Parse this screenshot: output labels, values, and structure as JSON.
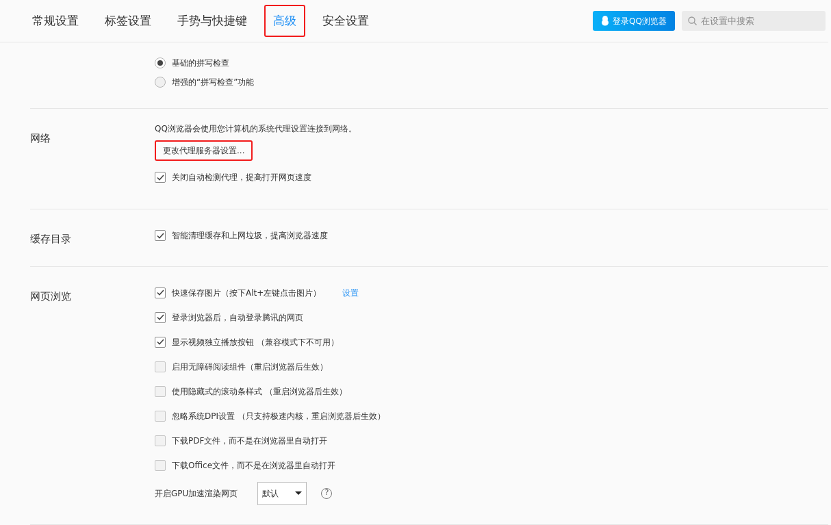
{
  "tabs": [
    {
      "label": "常规设置",
      "selected": false,
      "highlighted": false
    },
    {
      "label": "标签设置",
      "selected": false,
      "highlighted": false
    },
    {
      "label": "手势与快捷键",
      "selected": false,
      "highlighted": false
    },
    {
      "label": "高级",
      "selected": true,
      "highlighted": true
    },
    {
      "label": "安全设置",
      "selected": false,
      "highlighted": false
    }
  ],
  "login_button": {
    "label": "登录QQ浏览器"
  },
  "search": {
    "placeholder": "在设置中搜索"
  },
  "sections": [
    {
      "items": [
        {
          "kind": "radio",
          "label": "基础的拼写检查",
          "selected": true
        },
        {
          "kind": "radio",
          "label": "增强的“拼写检查”功能",
          "selected": false
        }
      ]
    },
    {
      "title": "网络",
      "items": [
        {
          "kind": "text",
          "label": "QQ浏览器会使用您计算机的系统代理设置连接到网络。"
        },
        {
          "kind": "button",
          "label": "更改代理服务器设置...",
          "highlighted": true
        },
        {
          "kind": "checkbox",
          "label": "关闭自动检测代理，提高打开网页速度",
          "checked": true
        }
      ]
    },
    {
      "title": "缓存目录",
      "items": [
        {
          "kind": "checkbox",
          "label": "智能清理缓存和上网垃圾，提高浏览器速度",
          "checked": true
        }
      ]
    },
    {
      "title": "网页浏览",
      "items": [
        {
          "kind": "checkbox",
          "label": "快速保存图片（按下Alt+左键点击图片）",
          "checked": true,
          "link": "设置"
        },
        {
          "kind": "checkbox",
          "label": "登录浏览器后，自动登录腾讯的网页",
          "checked": true
        },
        {
          "kind": "checkbox",
          "label": "显示视频独立播放按钮 （兼容模式下不可用）",
          "checked": true
        },
        {
          "kind": "checkbox",
          "label": "启用无障碍阅读组件（重启浏览器后生效）",
          "checked": false
        },
        {
          "kind": "checkbox",
          "label": "使用隐藏式的滚动条样式 （重启浏览器后生效）",
          "checked": false
        },
        {
          "kind": "checkbox",
          "label": "忽略系统DPI设置 （只支持极速内核，重启浏览器后生效）",
          "checked": false
        },
        {
          "kind": "checkbox",
          "label": "下载PDF文件，而不是在浏览器里自动打开",
          "checked": false
        },
        {
          "kind": "checkbox",
          "label": "下载Office文件，而不是在浏览器里自动打开",
          "checked": false
        },
        {
          "kind": "select",
          "label": "开启GPU加速渲染网页",
          "value": "默认",
          "help": "?"
        }
      ]
    }
  ]
}
